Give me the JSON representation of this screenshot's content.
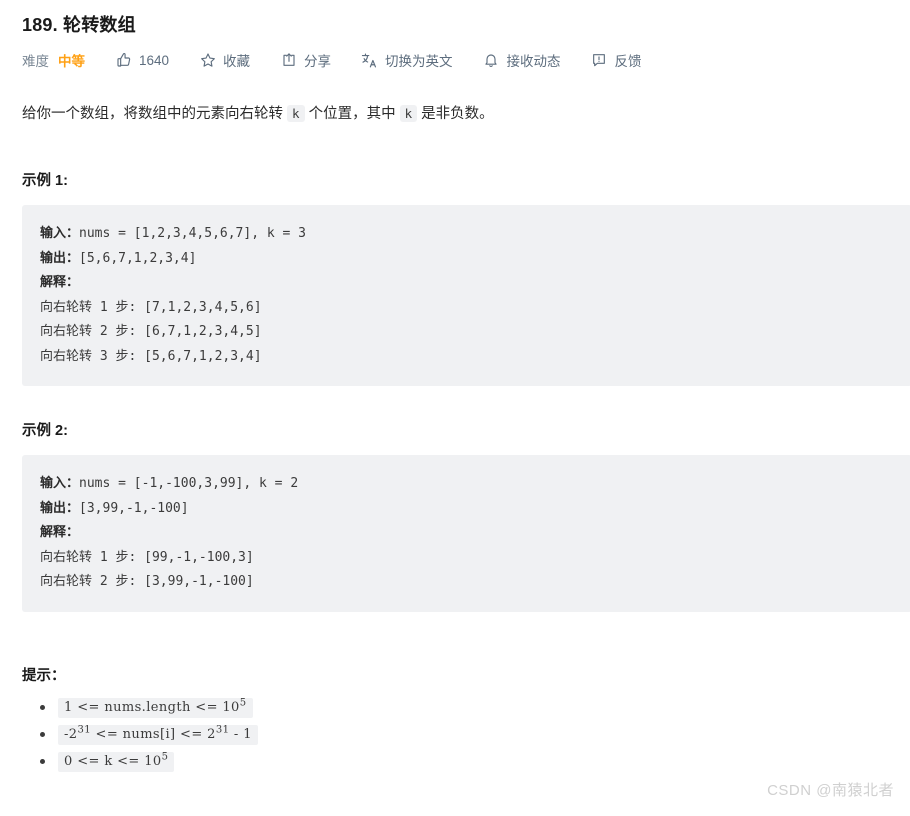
{
  "problem": {
    "title": "189. 轮转数组",
    "difficulty_label": "难度",
    "difficulty_value": "中等"
  },
  "toolbar": {
    "likes": {
      "icon": "thumbs-up-icon",
      "count": "1640"
    },
    "favorite": {
      "icon": "star-icon",
      "label": "收藏"
    },
    "share": {
      "icon": "share-icon",
      "label": "分享"
    },
    "translate": {
      "icon": "translate-icon",
      "label": "切换为英文"
    },
    "subscribe": {
      "icon": "bell-icon",
      "label": "接收动态"
    },
    "feedback": {
      "icon": "feedback-icon",
      "label": "反馈"
    }
  },
  "description": {
    "part1": "给你一个数组，将数组中的元素向右轮转 ",
    "code1": "k",
    "part2": " 个位置，其中 ",
    "code2": "k",
    "part3": " 是非负数。"
  },
  "examples": [
    {
      "heading": "示例 1:",
      "input_label": "输入：",
      "input_value": "nums = [1,2,3,4,5,6,7], k = 3",
      "output_label": "输出：",
      "output_value": "[5,6,7,1,2,3,4]",
      "explain_label": "解释：",
      "steps": [
        "向右轮转 1 步: [7,1,2,3,4,5,6]",
        "向右轮转 2 步: [6,7,1,2,3,4,5]",
        "向右轮转 3 步: [5,6,7,1,2,3,4]"
      ]
    },
    {
      "heading": "示例 2:",
      "input_label": "输入：",
      "input_value": "nums = [-1,-100,3,99], k = 2",
      "output_label": "输出：",
      "output_value": "[3,99,-1,-100]",
      "explain_label": "解释：",
      "steps": [
        "向右轮转 1 步: [99,-1,-100,3]",
        "向右轮转 2 步: [3,99,-1,-100]"
      ]
    }
  ],
  "hints": {
    "heading": "提示：",
    "items": [
      {
        "pre": "1 <= nums.length <= 10",
        "sup": "5",
        "post": ""
      },
      {
        "pre": "-2",
        "sup": "31",
        "mid": " <= nums[i] <= 2",
        "sup2": "31",
        "post": " - 1"
      },
      {
        "pre": "0 <= k <= 10",
        "sup": "5",
        "post": ""
      }
    ]
  },
  "watermark": "CSDN @南猿北者"
}
